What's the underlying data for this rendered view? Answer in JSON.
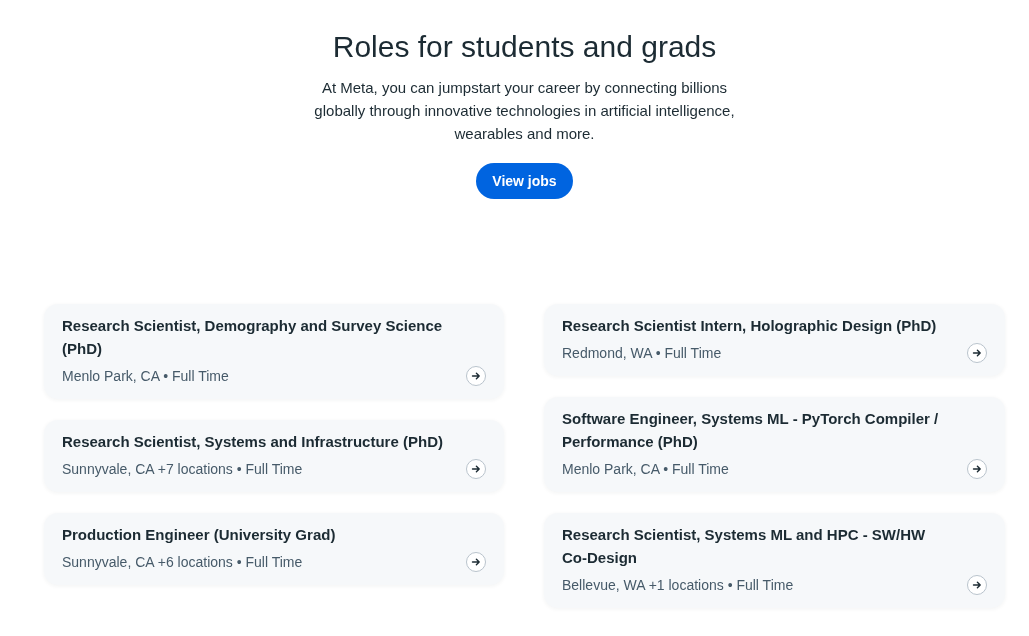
{
  "header": {
    "title": "Roles for students and grads",
    "description": "At Meta, you can jumpstart your career by connecting billions globally through innovative technologies in artificial intelligence, wearables and more.",
    "button": {
      "label": "View jobs"
    }
  },
  "job_columns": [
    {
      "jobs": [
        {
          "title": "Research Scientist, Demography and Survey Science (PhD)",
          "details": "Menlo Park, CA • Full Time"
        },
        {
          "title": "Research Scientist, Systems and Infrastructure (PhD)",
          "details": "Sunnyvale, CA +7 locations • Full Time"
        },
        {
          "title": "Production Engineer (University Grad)",
          "details": "Sunnyvale, CA +6 locations • Full Time"
        }
      ]
    },
    {
      "jobs": [
        {
          "title": "Research Scientist Intern, Holographic Design (PhD)",
          "details": "Redmond, WA • Full Time"
        },
        {
          "title": "Software Engineer, Systems ML - PyTorch Compiler / Performance (PhD)",
          "details": "Menlo Park, CA • Full Time"
        },
        {
          "title": "Research Scientist, Systems ML and HPC - SW/HW Co-Design",
          "details": "Bellevue, WA +1 locations • Full Time"
        }
      ]
    }
  ]
}
